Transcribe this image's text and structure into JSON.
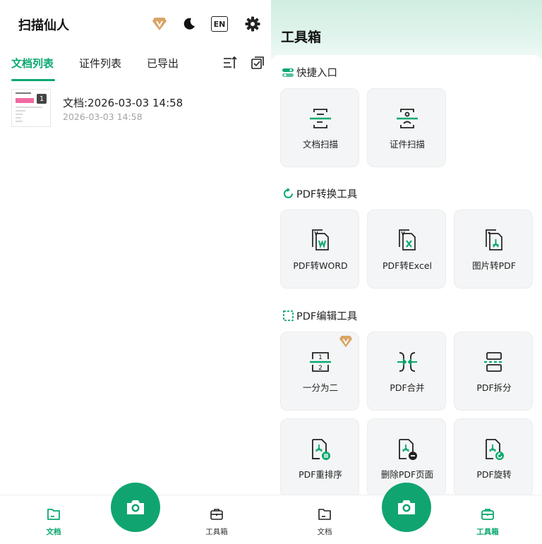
{
  "left": {
    "app_title": "扫描仙人",
    "header_icons": [
      "vip-diamond-icon",
      "moon-icon",
      "language-icon",
      "gear-icon"
    ],
    "language_label": "EN",
    "tabs": [
      {
        "label": "文档列表",
        "active": true
      },
      {
        "label": "证件列表",
        "active": false
      },
      {
        "label": "已导出",
        "active": false
      }
    ],
    "documents": [
      {
        "title": "文档:2026-03-03 14:58",
        "date": "2026-03-03 14:58",
        "page_count": "1"
      }
    ]
  },
  "right": {
    "title": "工具箱",
    "sections": [
      {
        "title": "快捷入口",
        "items": [
          {
            "label": "文档扫描",
            "icon": "doc-scan-icon"
          },
          {
            "label": "证件扫描",
            "icon": "id-scan-icon"
          }
        ]
      },
      {
        "title": "PDF转换工具",
        "items": [
          {
            "label": "PDF转WORD",
            "icon": "pdf-to-word-icon"
          },
          {
            "label": "PDF转Excel",
            "icon": "pdf-to-excel-icon"
          },
          {
            "label": "图片转PDF",
            "icon": "image-to-pdf-icon"
          }
        ]
      },
      {
        "title": "PDF编辑工具",
        "items": [
          {
            "label": "一分为二",
            "icon": "split-in-two-icon",
            "vip": true
          },
          {
            "label": "PDF合并",
            "icon": "pdf-merge-icon"
          },
          {
            "label": "PDF拆分",
            "icon": "pdf-split-icon"
          },
          {
            "label": "PDF重排序",
            "icon": "pdf-reorder-icon"
          },
          {
            "label": "删除PDF页面",
            "icon": "pdf-delete-page-icon"
          },
          {
            "label": "PDF旋转",
            "icon": "pdf-rotate-icon"
          }
        ]
      }
    ]
  },
  "nav_left": {
    "items": [
      {
        "label": "文档",
        "active": true
      },
      {
        "label": "工具箱",
        "active": false
      }
    ]
  },
  "nav_right": {
    "items": [
      {
        "label": "文档",
        "active": false
      },
      {
        "label": "工具箱",
        "active": true
      }
    ]
  },
  "colors": {
    "accent": "#0aa86e",
    "vip_gold": "#d9a466",
    "card_bg": "#f4f5f6"
  }
}
